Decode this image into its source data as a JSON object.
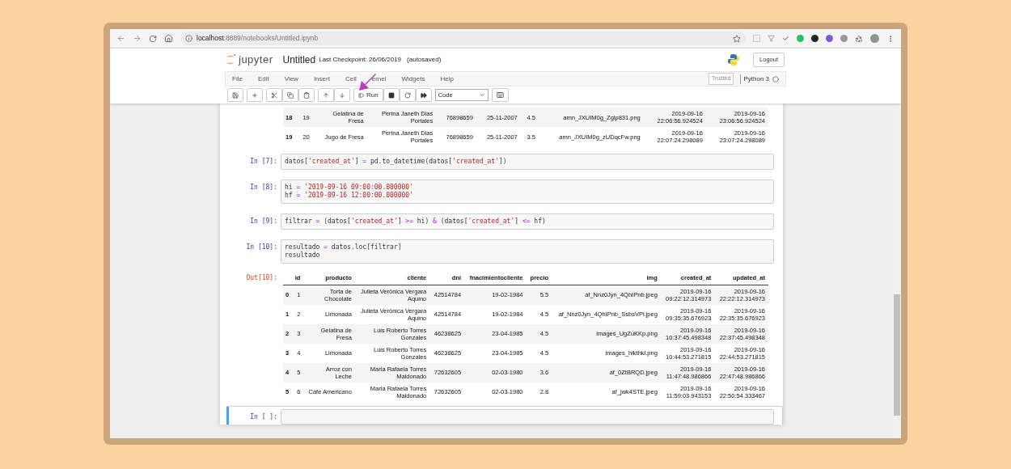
{
  "browser": {
    "url_host": "localhost",
    "url_path": ":8889/notebooks/Untitled.ipynb"
  },
  "header": {
    "logo_text": "jupyter",
    "notebook_name": "Untitled",
    "checkpoint": "Last Checkpoint: 26/06/2019",
    "autosave": "(autosaved)",
    "logout": "Logout"
  },
  "menu": [
    "File",
    "Edit",
    "View",
    "Insert",
    "Cell",
    "ernel",
    "Widgets",
    "Help"
  ],
  "trusted": "Trusted",
  "kernel": "Python 3",
  "toolbar": {
    "run": "Run",
    "cell_type": "Code"
  },
  "cells": [
    {
      "kind": "table",
      "selected": false,
      "rows": [
        {
          "index": "18",
          "cells": [
            "19",
            "Gelatina de\nFresa",
            "Perina Janeth Dias\nPortales",
            "76898659",
            "25-11-2007",
            "4.5",
            "amn_JXUIM0g_Zgip831.png",
            "2019-09-16\n22:06:56.924524",
            "2019-09-16\n23:06:56.924524"
          ]
        },
        {
          "index": "19",
          "cells": [
            "20",
            "Jugo de Fresa",
            "Perina Janeth Dias\nPortales",
            "76898659",
            "25-11-2007",
            "3.5",
            "amn_JXUIM0g_zUDqcFw.png",
            "2019-09-16\n22:07:24.298089",
            "2019-09-16\n23:07:24.298089"
          ]
        }
      ]
    },
    {
      "kind": "code",
      "prompt": "In [7]:",
      "selected": false,
      "lines": [
        [
          {
            "text": "datos[",
            "kind": "name"
          },
          {
            "text": "'created_at'",
            "kind": "string"
          },
          {
            "text": "] ",
            "kind": "name"
          },
          {
            "text": "=",
            "kind": "operator"
          },
          {
            "text": " pd.to_datetime",
            "kind": "name"
          },
          {
            "text": "(",
            "kind": "bracket"
          },
          {
            "text": "datos[",
            "kind": "name"
          },
          {
            "text": "'created_at'",
            "kind": "string"
          },
          {
            "text": "]",
            "kind": "name"
          },
          {
            "text": ")",
            "kind": "bracket"
          }
        ]
      ]
    },
    {
      "kind": "code",
      "prompt": "In [8]:",
      "selected": false,
      "lines": [
        [
          {
            "text": "hi ",
            "kind": "name"
          },
          {
            "text": "= ",
            "kind": "operator"
          },
          {
            "text": "'2019-09-16 09:00:00.000000'",
            "kind": "string"
          }
        ],
        [
          {
            "text": "hf ",
            "kind": "name"
          },
          {
            "text": "= ",
            "kind": "operator"
          },
          {
            "text": "'2019-09-16 12:00:00.000000'",
            "kind": "string"
          }
        ]
      ]
    },
    {
      "kind": "code",
      "prompt": "In [9]:",
      "selected": false,
      "lines": [
        [
          {
            "text": "filtrar ",
            "kind": "name"
          },
          {
            "text": "= ",
            "kind": "operator"
          },
          {
            "text": "(",
            "kind": "bracket"
          },
          {
            "text": "datos[",
            "kind": "name"
          },
          {
            "text": "'created_at'",
            "kind": "string"
          },
          {
            "text": "] ",
            "kind": "name"
          },
          {
            "text": ">=",
            "kind": "operator"
          },
          {
            "text": " hi",
            "kind": "name"
          },
          {
            "text": ") ",
            "kind": "bracket"
          },
          {
            "text": "& ",
            "kind": "operator"
          },
          {
            "text": "(",
            "kind": "bracket"
          },
          {
            "text": "datos[",
            "kind": "name"
          },
          {
            "text": "'created_at'",
            "kind": "string"
          },
          {
            "text": "] ",
            "kind": "name"
          },
          {
            "text": "<=",
            "kind": "operator"
          },
          {
            "text": " hf",
            "kind": "name"
          },
          {
            "text": ")",
            "kind": "bracket"
          }
        ]
      ]
    },
    {
      "kind": "code",
      "prompt": "In [10]:",
      "selected": false,
      "lines": [
        [
          {
            "text": "resultado ",
            "kind": "name"
          },
          {
            "text": "=",
            "kind": "operator"
          },
          {
            "text": " datos.loc",
            "kind": "name"
          },
          {
            "text": "[",
            "kind": "bracket"
          },
          {
            "text": "filtrar",
            "kind": "name"
          },
          {
            "text": "]",
            "kind": "bracket"
          }
        ],
        [
          {
            "text": "resultado",
            "kind": "name"
          }
        ]
      ]
    },
    {
      "kind": "table",
      "prompt": "Out[10]:",
      "selected": false,
      "columns": [
        "id",
        "producto",
        "cliente",
        "dni",
        "fnacimientocliente",
        "precio",
        "img",
        "created_at",
        "updated_at"
      ],
      "rows": [
        {
          "index": "0",
          "cells": [
            "1",
            "Torta de\nChocolate",
            "Julieta Verônica Vergara\nAquino",
            "42514784",
            "19-02-1984",
            "5.5",
            "af_Nnz0Jyn_4QhIPnb.jpeg",
            "2019-09-16\n09:22:12.314973",
            "2019-09-16\n22:22:12.314973"
          ]
        },
        {
          "index": "1",
          "cells": [
            "2",
            "Limonada",
            "Julieta Verônica Vergara\nAquino",
            "42514784",
            "19-02-1984",
            "4.5",
            "af_Nnz0Jyn_4QhIPnb_SsbsVPi.jpeg",
            "2019-09-16\n09:35:35.676923",
            "2019-09-16\n22:35:35.676923"
          ]
        },
        {
          "index": "2",
          "cells": [
            "3",
            "Gelatina de\nFresa",
            "Luis Roberto Torres\nGonzales",
            "46238625",
            "23-04-1985",
            "4.5",
            "images_UgZuKKp.png",
            "2019-09-16\n10:37:45.498348",
            "2019-09-16\n22:37:45.498348"
          ]
        },
        {
          "index": "3",
          "cells": [
            "4",
            "Limonada",
            "Luis Roberto Torres\nGonzales",
            "46238625",
            "23-04-1985",
            "4.5",
            "images_hlkthkl.png",
            "2019-09-16\n10:44:53.271815",
            "2019-09-16\n22:44:53.271815"
          ]
        },
        {
          "index": "4",
          "cells": [
            "5",
            "Arroz con\nLeche",
            "Maria Rafaela Torres\nMaldonado",
            "72632605",
            "02-03-1980",
            "3.6",
            "af_0ZtBRQD.jpeg",
            "2019-09-16\n11:47:48.986866",
            "2019-09-16\n22:47:48.986866"
          ]
        },
        {
          "index": "5",
          "cells": [
            "6",
            "Cafe Americano",
            "Maria Rafaela Torres\nMaldonado",
            "72632605",
            "02-03-1980",
            "2.8",
            "af_jwk4STE.jpeg",
            "2019-09-16\n11:59:03.943153",
            "2019-09-16\n22:50:54.333467"
          ]
        }
      ]
    },
    {
      "kind": "code",
      "prompt": "In [ ]:",
      "selected": true
    }
  ]
}
